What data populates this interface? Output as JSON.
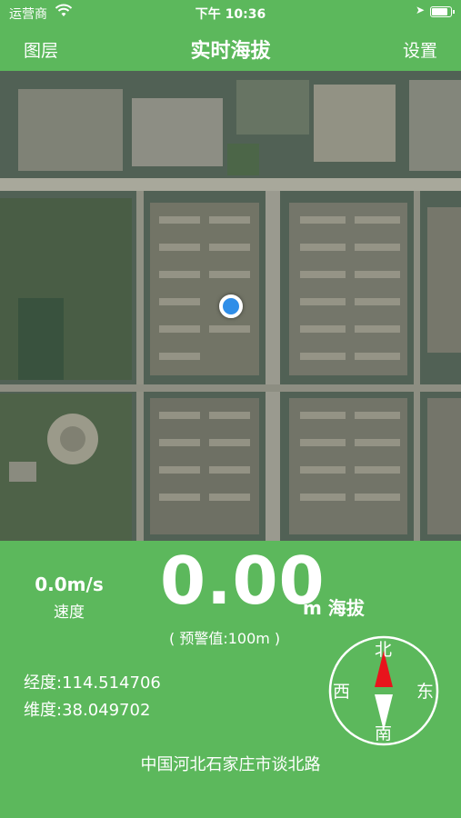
{
  "status_bar": {
    "carrier": "运营商",
    "time": "下午 10:36",
    "battery_level": 0.9
  },
  "nav": {
    "left_label": "图层",
    "title": "实时海拔",
    "right_label": "设置"
  },
  "colors": {
    "theme_green": "#5cb85c",
    "location_dot": "#2f8ee8",
    "compass_north": "#e8141c"
  },
  "panel": {
    "speed_value": "0.0m/s",
    "speed_label": "速度",
    "altitude_value": "0.00",
    "altitude_unit": "m 海拔",
    "warning": "( 预警值:100m )",
    "longitude": "经度:114.514706",
    "latitude": "维度:38.049702",
    "compass": {
      "north": "北",
      "south": "南",
      "west": "西",
      "east": "东"
    },
    "address": "中国河北石家庄市谈北路"
  }
}
